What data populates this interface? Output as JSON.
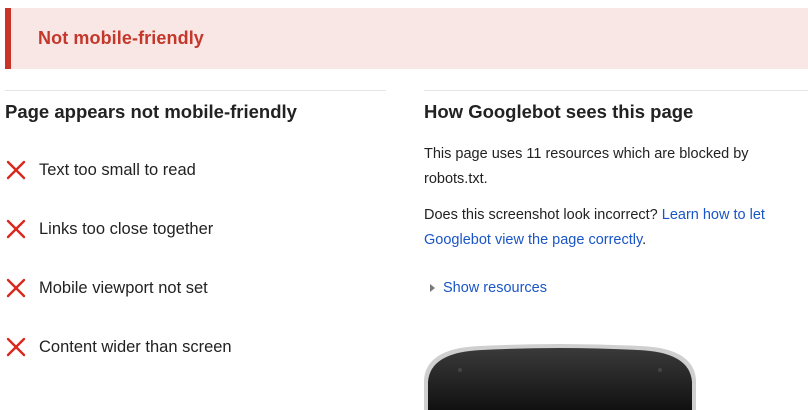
{
  "banner": {
    "title": "Not mobile-friendly"
  },
  "left": {
    "heading": "Page appears not mobile-friendly",
    "issues": [
      {
        "label": "Text too small to read",
        "icon": "x-icon"
      },
      {
        "label": "Links too close together",
        "icon": "x-icon"
      },
      {
        "label": "Mobile viewport not set",
        "icon": "x-icon"
      },
      {
        "label": "Content wider than screen",
        "icon": "x-icon"
      }
    ]
  },
  "right": {
    "heading": "How Googlebot sees this page",
    "blocked_text": "This page uses 11 resources which are blocked by robots.txt.",
    "incorrect_prefix": "Does this screenshot look incorrect? ",
    "learn_link": "Learn how to let Googlebot view the page correctly",
    "incorrect_suffix": ".",
    "show_resources": "Show resources"
  },
  "colors": {
    "error_red": "#c4372b",
    "banner_bg": "#f9e7e5",
    "link_blue": "#1a55c7"
  }
}
